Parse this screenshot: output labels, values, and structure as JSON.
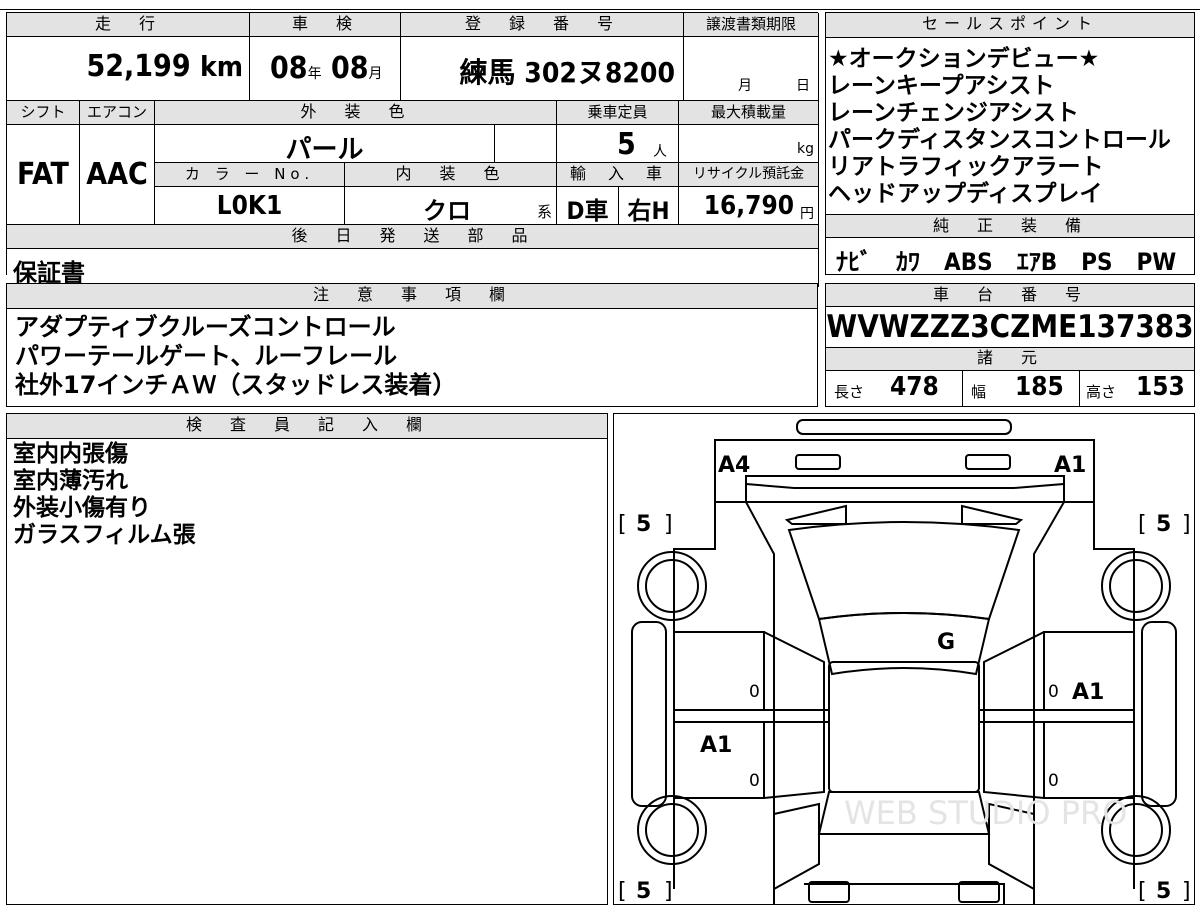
{
  "headers": {
    "mileage": "走　行",
    "inspection": "車　検",
    "registration": "登　録　番　号",
    "deadline": "譲渡書類期限",
    "sales_points": "セールスポイント",
    "shift": "シフト",
    "aircon": "エアコン",
    "exterior_color": "外　装　色",
    "capacity": "乗車定員",
    "max_load": "最大積載量",
    "color_no": "カ ラ ー No.",
    "interior_color": "内　装　色",
    "import": "輸　入　車",
    "recycle": "リサイクル預託金",
    "later_parts": "後　日　発　送　部　品",
    "genuine_equipment": "純　正　装　備",
    "notes": "注　意　事　項　欄",
    "chassis_no": "車　台　番　号",
    "specs": "諸　元",
    "inspector": "検　査　員　記　入　欄"
  },
  "vehicle": {
    "mileage_value": "52,199",
    "mileage_unit": "km",
    "inspection_year": "08",
    "year_unit": "年",
    "inspection_month": "08",
    "month_unit": "月",
    "registration_number": "練馬 302ヌ8200",
    "deadline_month_unit": "月",
    "deadline_day_unit": "日",
    "shift": "FAT",
    "aircon": "AAC",
    "exterior_color": "パール",
    "capacity_value": "5",
    "capacity_unit": "人",
    "max_load_unit": "kg",
    "color_no": "L0K1",
    "interior_color": "クロ",
    "interior_suffix": "系",
    "import_type": "D車",
    "handle": "右H",
    "recycle_fee": "16,790",
    "recycle_unit": "円",
    "later_parts": "保証書",
    "genuine_equipment": "ﾅﾋﾞ　ｶﾜ　ABS　ｴｱB　PS　PW",
    "chassis_no": "WVWZZZ3CZME137383",
    "length_label": "長さ",
    "length": "478",
    "width_label": "幅",
    "width": "185",
    "height_label": "高さ",
    "height": "153"
  },
  "sales_points": [
    "★オークションデビュー★",
    "レーンキープアシスト",
    "レーンチェンジアシスト",
    "パークディスタンスコントロール",
    "リアトラフィックアラート",
    "ヘッドアップディスプレイ"
  ],
  "notes": [
    "アダプティブクルーズコントロール",
    "パワーテールゲート、ルーフレール",
    "社外17インチＡＷ（スタッドレス装着）"
  ],
  "inspector_notes": [
    "室内内張傷",
    "室内薄汚れ",
    "外装小傷有り",
    "ガラスフィルム張"
  ],
  "diagram": {
    "marks": {
      "front_left": "A4",
      "front_right": "A1",
      "windshield": "G",
      "right_front_door": "A1",
      "left_rear_door": "A1"
    },
    "door_zeros": [
      "0",
      "0",
      "0",
      "0"
    ],
    "tires": {
      "front_left": "5",
      "front_right": "5",
      "rear_left": "5",
      "rear_right": "5"
    },
    "bracket_open": "[",
    "bracket_close": "]",
    "watermark": "WEB STUDIO PRO"
  }
}
